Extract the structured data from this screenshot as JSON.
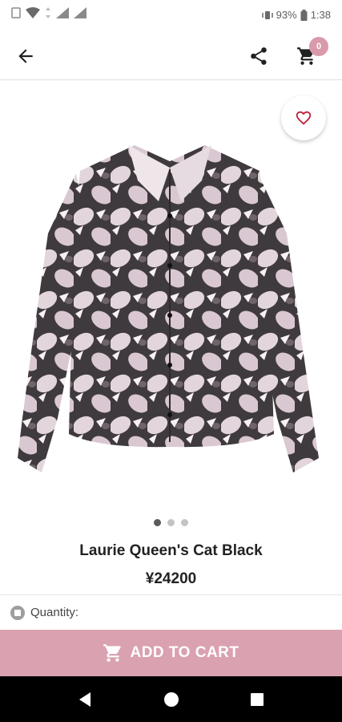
{
  "status_bar": {
    "battery": "93%",
    "time": "1:38"
  },
  "app_bar": {
    "cart_count": "0"
  },
  "gallery": {
    "page_count": 3,
    "active_index": 0
  },
  "product": {
    "name": "Laurie Queen's Cat Black",
    "price": "¥24200"
  },
  "quantity": {
    "label": "Quantity:"
  },
  "cta": {
    "label": "ADD TO CART"
  },
  "colors": {
    "accent": "#daa1b0",
    "badge": "#d99aaa",
    "heart": "#c0203f"
  },
  "icons": [
    "back-arrow-icon",
    "share-icon",
    "cart-icon",
    "heart-icon",
    "cart-icon",
    "back-icon",
    "home-icon",
    "recents-icon"
  ]
}
